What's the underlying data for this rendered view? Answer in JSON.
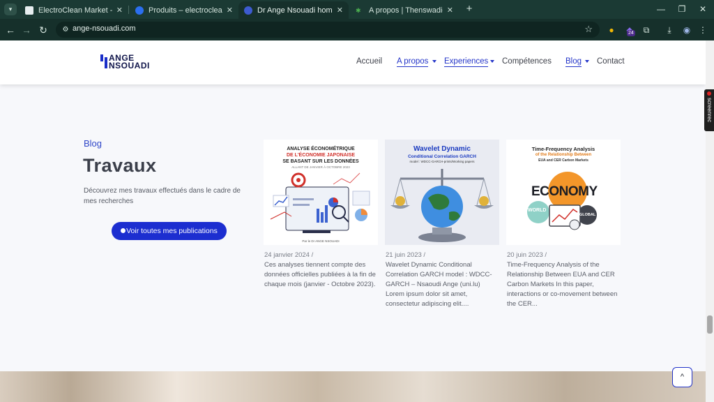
{
  "browser": {
    "tabs": [
      {
        "title": "ElectroClean Market - Vision M",
        "active": false,
        "favicon_color": "#e7eef0"
      },
      {
        "title": "Produits – electroclean",
        "active": false,
        "favicon_color": "#2b6ff0"
      },
      {
        "title": "Dr Ange Nsouadi home - Ange",
        "active": true,
        "favicon_color": "#3d5bd0"
      },
      {
        "title": "A propos | Thenswadicast",
        "active": false,
        "favicon_color": "#2e7d32"
      }
    ],
    "new_tab": "+",
    "url": "ange-nsouadi.com",
    "extension_badge": "24"
  },
  "site": {
    "logo": {
      "line1": "ANGE",
      "line2": "NSOUADI"
    },
    "menu": [
      {
        "label": "Accueil",
        "highlight": false,
        "dropdown": false
      },
      {
        "label": "A propos",
        "highlight": true,
        "dropdown": true
      },
      {
        "label": "Experiences",
        "highlight": true,
        "dropdown": true
      },
      {
        "label": "Compétences",
        "highlight": false,
        "dropdown": false
      },
      {
        "label": "Blog",
        "highlight": true,
        "dropdown": true
      },
      {
        "label": "Contact",
        "highlight": false,
        "dropdown": false
      }
    ]
  },
  "section": {
    "label": "Blog",
    "title": "Travaux",
    "intro": "Découvrez mes travaux effectués dans le cadre de mes recherches",
    "cta": "Voir toutes mes publications"
  },
  "cards": [
    {
      "date": "24 janvier 2024 /",
      "excerpt": "Ces analyses tiennent compte des données officielles publiées à la fin de chaque mois (janvier - Octobre 2023).",
      "thumb": {
        "line1": "ANALYSE ÉCONOMÉTRIQUE",
        "line2": "DE L'ÉCONOMIE JAPONAISE",
        "line3": "SE BASANT SUR LES DONNÉES",
        "line4": "ALLANT DE JANVIER À OCTOBRE 2023",
        "footer": "Par le Dr ANGE NSOUADI"
      }
    },
    {
      "date": "21 juin 2023 /",
      "excerpt": "Wavelet Dynamic Conditional Correlation GARCH model : WDCC-GARCH – Nsaoudi Ange (uni.lu) Lorem ipsum dolor sit amet, consectetur adipiscing elit....",
      "thumb": {
        "line1": "Wavelet Dynamic",
        "line2": "Conditional Correlation GARCH",
        "line3": "model : WDCC-GARCH-prints/Working papers"
      }
    },
    {
      "date": "20 juin 2023 /",
      "excerpt": "Time-Frequency Analysis of the Relationship Between EUA and CER Carbon Markets In this paper, interactions or co-movement between the CER...",
      "thumb": {
        "line1": "Time-Frequency Analysis",
        "line2": "of the Relationship Between",
        "line3": "EUA and CER Carbon Markets",
        "word1": "ECONOMY",
        "word2": "WORLD",
        "word3": "GLOBAL"
      }
    }
  ],
  "overlay": {
    "screenrec": "screenrec",
    "to_top": "^"
  }
}
